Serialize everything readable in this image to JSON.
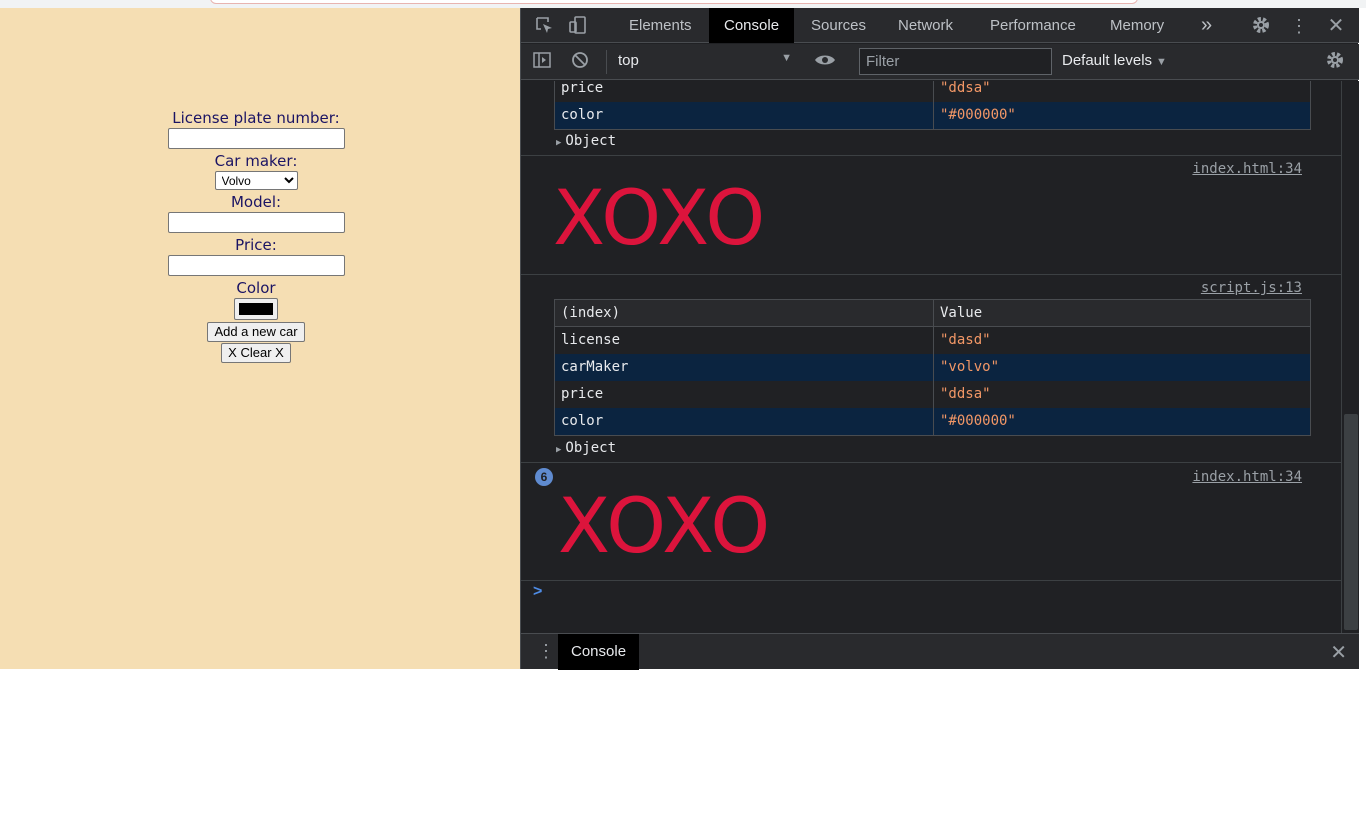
{
  "form": {
    "license_label": "License plate number:",
    "maker_label": "Car maker:",
    "maker_selected": "Volvo",
    "model_label": "Model:",
    "price_label": "Price:",
    "color_label": "Color",
    "color_value": "#000000",
    "add_button": "Add a new car",
    "clear_button": "X Clear X"
  },
  "devtools": {
    "tabs": [
      "Elements",
      "Console",
      "Sources",
      "Network",
      "Performance",
      "Memory"
    ],
    "active_tab": "Console",
    "more_tabs": "»",
    "context": "top",
    "filter_placeholder": "Filter",
    "levels": "Default levels",
    "drawer_tab": "Console"
  },
  "console": {
    "partial_table": [
      {
        "key": "price",
        "value": "\"ddsa\""
      },
      {
        "key": "color",
        "value": "\"#000000\""
      }
    ],
    "object_label": "Object",
    "log1_source": "index.html:34",
    "log1_text": "XOXO",
    "table_source": "script.js:13",
    "table_headers": [
      "(index)",
      "Value"
    ],
    "table_rows": [
      {
        "key": "license",
        "value": "\"dasd\""
      },
      {
        "key": "carMaker",
        "value": "\"volvo\""
      },
      {
        "key": "price",
        "value": "\"ddsa\""
      },
      {
        "key": "color",
        "value": "\"#000000\""
      }
    ],
    "log2_count": "6",
    "log2_source": "index.html:34",
    "log2_text": "XOXO",
    "prompt": ">"
  },
  "colors": {
    "page_background": "#f5deb3",
    "form_text": "#1b1464",
    "xoxo_red": "#dc143c",
    "string_orange": "#f29766",
    "row_highlight": "#0b2440"
  }
}
